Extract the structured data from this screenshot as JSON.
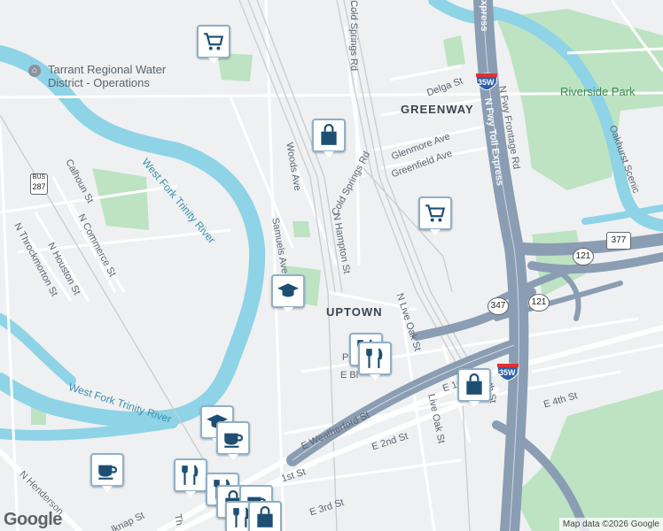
{
  "map": {
    "area_labels": {
      "greenway": "GREENWAY",
      "uptown": "UPTOWN"
    },
    "park_label": "Riverside Park",
    "water_labels": {
      "river_upper": "West Fork Trinity River",
      "river_lower": "West Fork Trinity River"
    },
    "place_label": {
      "line1": "Tarrant Regional Water",
      "line2": "District - Operations"
    },
    "streets": {
      "cold_springs_top": "Cold Springs Rd",
      "cold_springs": "Cold Springs Rd",
      "delga": "Delga St",
      "glenmore": "Glenmore Ave",
      "greenfield": "Greenfield Ave",
      "woods": "Woods Ave",
      "n_hampton": "N Hampton St",
      "samuels": "Samuels Ave",
      "calhoun": "Calhoun St",
      "n_commerce": "N Commerce St",
      "n_houston": "N Houston St",
      "n_throckmorton": "N Throckmorton St",
      "n_live_oak": "N Live Oak St",
      "live_oak": "Live Oak St",
      "e_weatherford": "E Weatherford St",
      "e_2nd": "E 2nd St",
      "e_3rd": "E 3rd St",
      "e_4th": "E 4th St",
      "e_1st": "E 1s",
      "first": "1st St",
      "belknap": "lknap St",
      "n_henderson": "N Henderson",
      "e_bl": "E Bl",
      "p_frag": "P",
      "th_frag": "Th",
      "n_fwy_frontage": "N Fwy Frontage Rd",
      "n_fwy_toll": "N Fwy Toll Express",
      "oakhurst": "Oakhurst Scenic",
      "express_top": "xpress",
      "n_fwy_top": "N F",
      "sh_fragment": "th St"
    },
    "highway_shields": {
      "i35w_north": "35W",
      "i35w_south": "35W",
      "us377": "377",
      "sh121": "121",
      "sh121b": "121",
      "sh347": "347",
      "bus287_top": "BUS",
      "bus287_num": "287"
    },
    "pois": [
      {
        "name": "shopping-cart",
        "icon": "cart-icon"
      },
      {
        "name": "shopping-bag",
        "icon": "bag-icon"
      },
      {
        "name": "shopping-cart",
        "icon": "cart-icon"
      },
      {
        "name": "school",
        "icon": "graduation-cap-icon"
      },
      {
        "name": "restaurant",
        "icon": "fork-knife-icon"
      },
      {
        "name": "restaurant",
        "icon": "fork-knife-icon"
      },
      {
        "name": "shopping-bag",
        "icon": "bag-icon"
      },
      {
        "name": "cafe",
        "icon": "coffee-cup-icon"
      },
      {
        "name": "cafe",
        "icon": "coffee-cup-icon"
      },
      {
        "name": "school",
        "icon": "graduation-cap-icon"
      },
      {
        "name": "restaurant",
        "icon": "fork-knife-icon"
      },
      {
        "name": "restaurant",
        "icon": "fork-knife-icon"
      }
    ],
    "colors": {
      "background": "#eef0f2",
      "water": "#8ed3e6",
      "park": "#bde3c2",
      "highway": "#8a9db3",
      "poi_icon": "#1d4f73"
    }
  },
  "footer": {
    "logo": "Google",
    "copyright": "Map data ©2026 Google"
  }
}
